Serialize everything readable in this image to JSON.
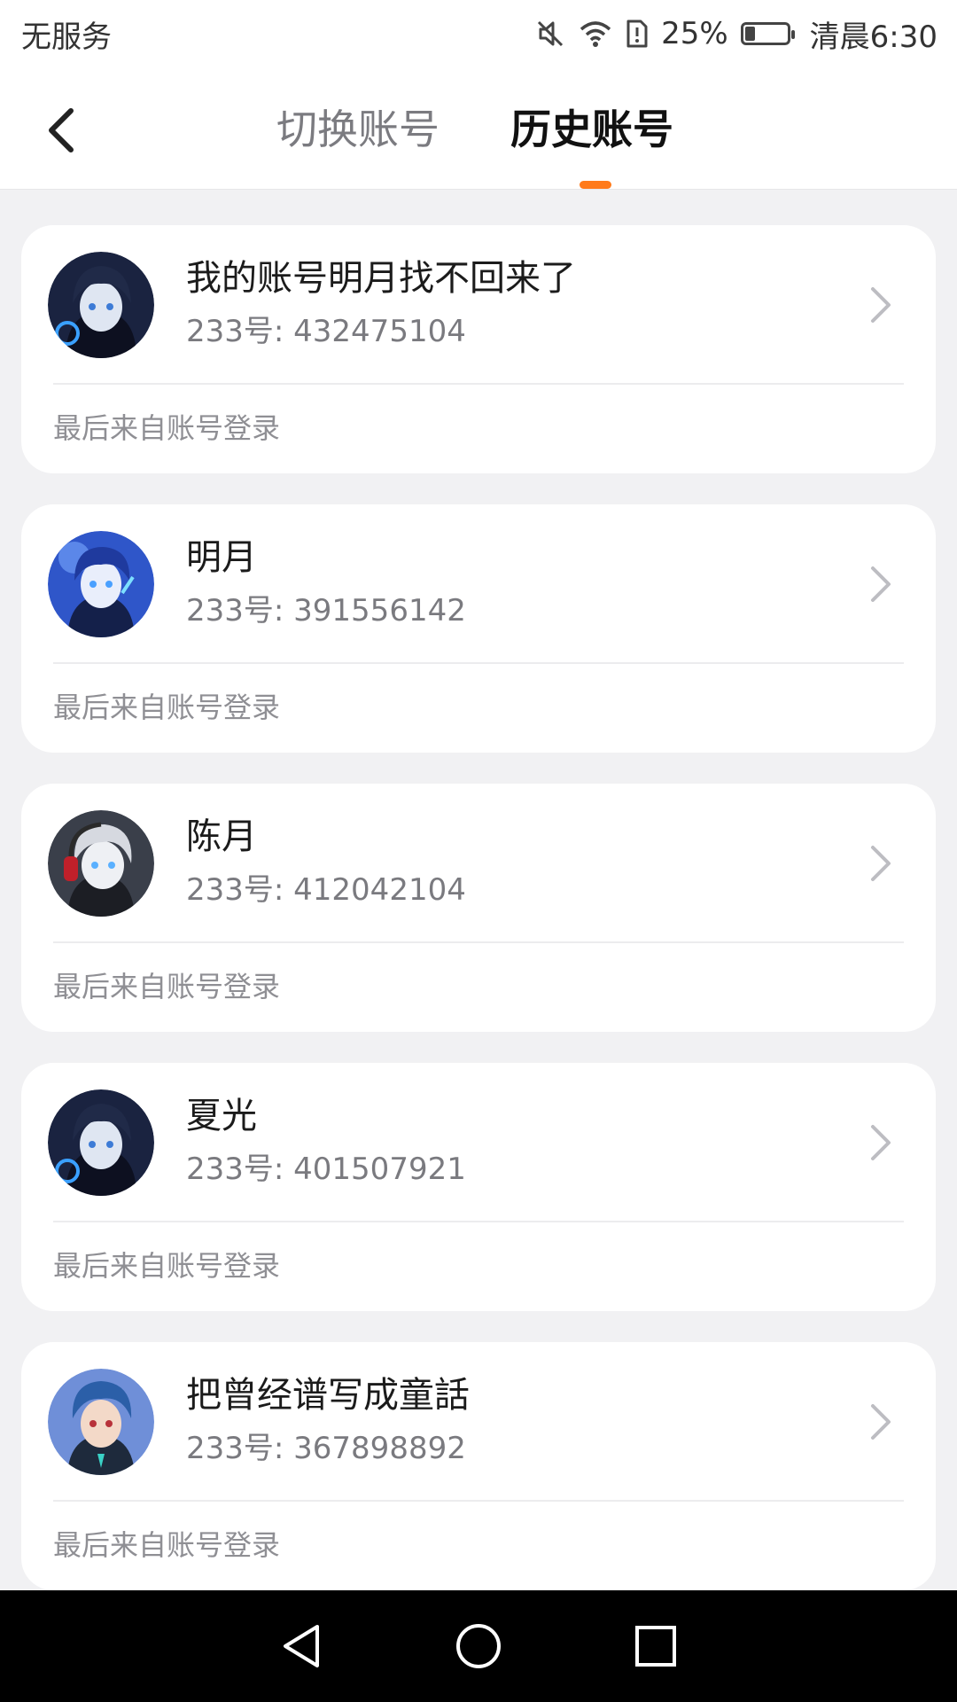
{
  "status_bar": {
    "carrier": "无服务",
    "battery_percent": "25%",
    "battery_level": 0.25,
    "time": "清晨6:30",
    "icons": [
      "mute-icon",
      "wifi-icon",
      "sim-alert-icon",
      "battery-icon"
    ]
  },
  "header": {
    "tabs": [
      {
        "label": "切换账号",
        "active": false
      },
      {
        "label": "历史账号",
        "active": true
      }
    ],
    "accent_color": "#ff7a1a"
  },
  "accounts": [
    {
      "name": "我的账号明月找不回来了",
      "id": "233号: 432475104",
      "source": "最后来自账号登录",
      "avatar": "anime-boy-dark-hood"
    },
    {
      "name": "明月",
      "id": "233号: 391556142",
      "source": "最后来自账号登录",
      "avatar": "anime-boy-blue"
    },
    {
      "name": "陈月",
      "id": "233号: 412042104",
      "source": "最后来自账号登录",
      "avatar": "anime-boy-silver-headphones"
    },
    {
      "name": "夏光",
      "id": "233号: 401507921",
      "source": "最后来自账号登录",
      "avatar": "anime-boy-dark-hood"
    },
    {
      "name": "把曾经谱写成童話",
      "id": "233号: 367898892",
      "source": "最后来自账号登录",
      "avatar": "anime-boy-blue-hair"
    }
  ],
  "nav_bar": {
    "buttons": [
      "back-triangle-icon",
      "home-circle-icon",
      "recents-square-icon"
    ]
  }
}
